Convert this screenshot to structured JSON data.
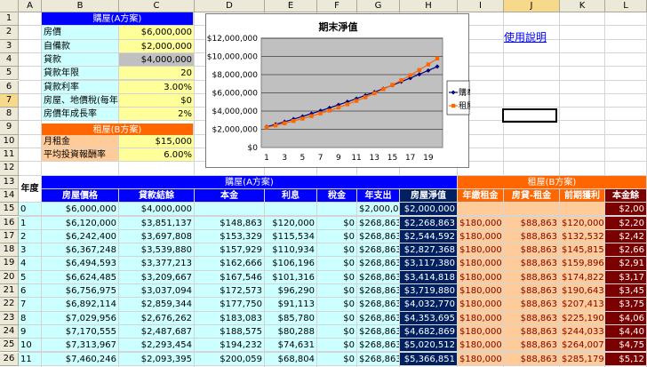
{
  "columns": [
    "A",
    "B",
    "C",
    "D",
    "E",
    "F",
    "G",
    "H",
    "I",
    "J",
    "K",
    "L"
  ],
  "rows": [
    "1",
    "2",
    "3",
    "4",
    "5",
    "6",
    "7",
    "8",
    "9",
    "10",
    "11",
    "12",
    "13",
    "14",
    "15",
    "16",
    "17",
    "18",
    "19",
    "20",
    "21",
    "22",
    "23",
    "24",
    "25",
    "26"
  ],
  "planA": {
    "header": "購屋(A方案)",
    "items": [
      {
        "label": "房價",
        "value": "$6,000,000"
      },
      {
        "label": "自備款",
        "value": "$2,000,000"
      },
      {
        "label": "貸款",
        "value": "$4,000,000"
      },
      {
        "label": "貸款年限",
        "value": "20"
      },
      {
        "label": "貸款利率",
        "value": "3.00%"
      },
      {
        "label": "房屋、地價稅(每年)",
        "value": "$0"
      },
      {
        "label": "房價年成長率",
        "value": "2%"
      }
    ]
  },
  "planB": {
    "header": "租屋(B方案)",
    "items": [
      {
        "label": "月租金",
        "value": "$15,000"
      },
      {
        "label": "平均投資報酬率",
        "value": "6.00%"
      }
    ]
  },
  "help_link": "使用說明",
  "colors": {
    "blue": "#0000ff",
    "orange": "#ff6600",
    "navy": "#002060",
    "darkred": "#7b0000",
    "cyan": "#ccffff",
    "peach": "#ffcc99",
    "yellow": "#ffff99",
    "gray": "#c0c0c0"
  },
  "table": {
    "year_header": "年度",
    "groupA": "購屋(A方案)",
    "groupB": "租屋(B方案)",
    "headers": [
      "房屋價格",
      "貸款結餘",
      "本金",
      "利息",
      "稅金",
      "年支出",
      "房屋淨值",
      "年繳租金",
      "房貸-租金",
      "前期獲利",
      "本金餘"
    ],
    "rows": [
      [
        "0",
        "$6,000,000",
        "$4,000,000",
        "",
        "",
        "",
        "$2,000,000",
        "$2,000,000",
        "",
        "",
        "",
        "$2,00"
      ],
      [
        "1",
        "$6,120,000",
        "$3,851,137",
        "$148,863",
        "$120,000",
        "$0",
        "$268,863",
        "$2,268,863",
        "$180,000",
        "$88,863",
        "$120,000",
        "$2,20"
      ],
      [
        "2",
        "$6,242,400",
        "$3,697,808",
        "$153,329",
        "$115,534",
        "$0",
        "$268,863",
        "$2,544,592",
        "$180,000",
        "$88,863",
        "$132,532",
        "$2,42"
      ],
      [
        "3",
        "$6,367,248",
        "$3,539,880",
        "$157,929",
        "$110,934",
        "$0",
        "$268,863",
        "$2,827,368",
        "$180,000",
        "$88,863",
        "$145,815",
        "$2,66"
      ],
      [
        "4",
        "$6,494,593",
        "$3,377,213",
        "$162,666",
        "$106,196",
        "$0",
        "$268,863",
        "$3,117,380",
        "$180,000",
        "$88,863",
        "$159,896",
        "$2,91"
      ],
      [
        "5",
        "$6,624,485",
        "$3,209,667",
        "$167,546",
        "$101,316",
        "$0",
        "$268,863",
        "$3,414,818",
        "$180,000",
        "$88,863",
        "$174,822",
        "$3,17"
      ],
      [
        "6",
        "$6,756,975",
        "$3,037,094",
        "$172,573",
        "$96,290",
        "$0",
        "$268,863",
        "$3,719,880",
        "$180,000",
        "$88,863",
        "$190,643",
        "$3,45"
      ],
      [
        "7",
        "$6,892,114",
        "$2,859,344",
        "$177,750",
        "$91,113",
        "$0",
        "$268,863",
        "$4,032,770",
        "$180,000",
        "$88,863",
        "$207,413",
        "$3,75"
      ],
      [
        "8",
        "$7,029,956",
        "$2,676,262",
        "$183,083",
        "$85,780",
        "$0",
        "$268,863",
        "$4,353,695",
        "$180,000",
        "$88,863",
        "$225,190",
        "$4,06"
      ],
      [
        "9",
        "$7,170,555",
        "$2,487,687",
        "$188,575",
        "$80,288",
        "$0",
        "$268,863",
        "$4,682,869",
        "$180,000",
        "$88,863",
        "$244,033",
        "$4,40"
      ],
      [
        "10",
        "$7,313,967",
        "$2,293,454",
        "$194,232",
        "$74,631",
        "$0",
        "$268,863",
        "$5,020,512",
        "$180,000",
        "$88,863",
        "$264,007",
        "$4,75"
      ],
      [
        "11",
        "$7,460,246",
        "$2,093,395",
        "$200,059",
        "$68,804",
        "$0",
        "$268,863",
        "$5,366,851",
        "$180,000",
        "$88,863",
        "$285,179",
        "$5,12"
      ]
    ]
  },
  "chart_data": {
    "type": "line",
    "title": "期末淨值",
    "x": [
      1,
      2,
      3,
      4,
      5,
      6,
      7,
      8,
      9,
      10,
      11,
      12,
      13,
      14,
      15,
      16,
      17,
      18,
      19,
      20
    ],
    "x_tick_labels": [
      "1",
      "3",
      "5",
      "7",
      "9",
      "11",
      "13",
      "15",
      "17",
      "19"
    ],
    "y_tick_labels": [
      "$0",
      "$2,000,000",
      "$4,000,000",
      "$6,000,000",
      "$8,000,000",
      "$10,000,000",
      "$12,000,000"
    ],
    "ylim": [
      0,
      12000000
    ],
    "grid": true,
    "legend": "right",
    "series": [
      {
        "name": "購奉",
        "color": "#000080",
        "values": [
          2268863,
          2544592,
          2827368,
          3117380,
          3414818,
          3719880,
          4032770,
          4353695,
          4682869,
          5020512,
          5366851,
          5722000,
          6085000,
          6457000,
          6838000,
          7228000,
          7628000,
          8037000,
          8457000,
          8886000
        ]
      },
      {
        "name": "租屋",
        "color": "#ff6600",
        "values": [
          2200000,
          2420000,
          2660000,
          2910000,
          3170000,
          3450000,
          3750000,
          4060000,
          4400000,
          4750000,
          5120000,
          5520000,
          5950000,
          6400000,
          6880000,
          7390000,
          7930000,
          8510000,
          9120000,
          9770000
        ]
      }
    ]
  }
}
